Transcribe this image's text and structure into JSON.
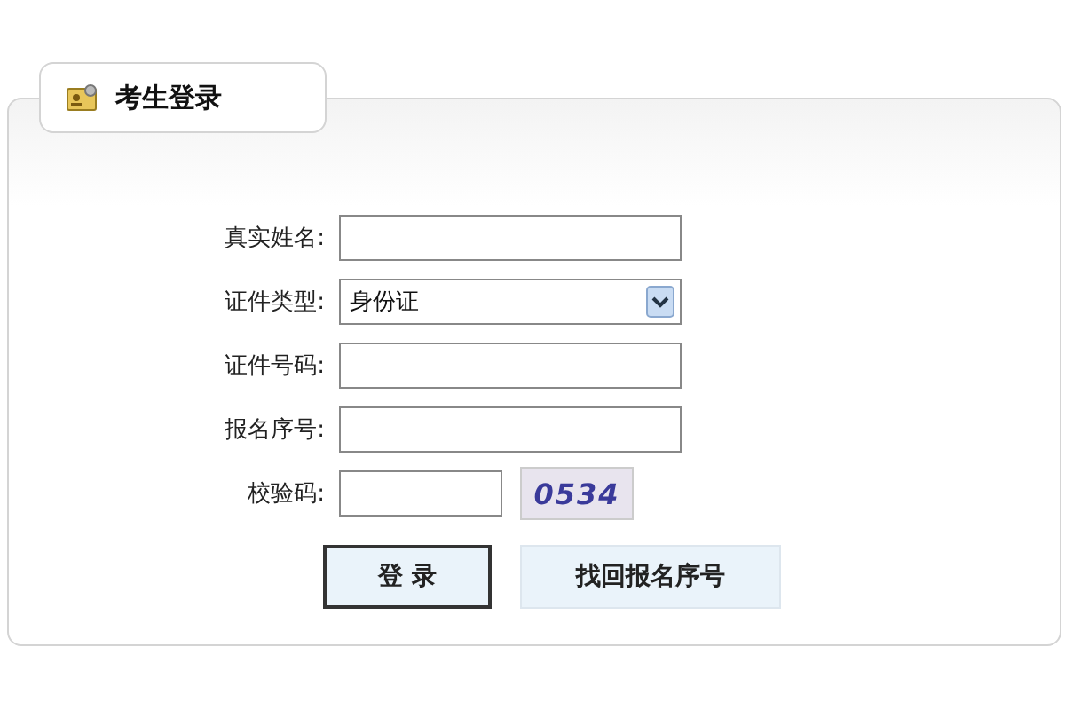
{
  "panel": {
    "title": "考生登录"
  },
  "fields": [
    {
      "kind": "input",
      "label": "真实姓名:"
    },
    {
      "kind": "select",
      "label": "证件类型:",
      "value": "身份证"
    },
    {
      "kind": "input",
      "label": "证件号码:"
    },
    {
      "kind": "input",
      "label": "报名序号:"
    },
    {
      "kind": "captcha",
      "label": "校验码:",
      "code": "0534"
    }
  ],
  "buttons": [
    {
      "label": "登 录",
      "kind": "primary"
    },
    {
      "label": "找回报名序号",
      "kind": "secondary"
    }
  ]
}
